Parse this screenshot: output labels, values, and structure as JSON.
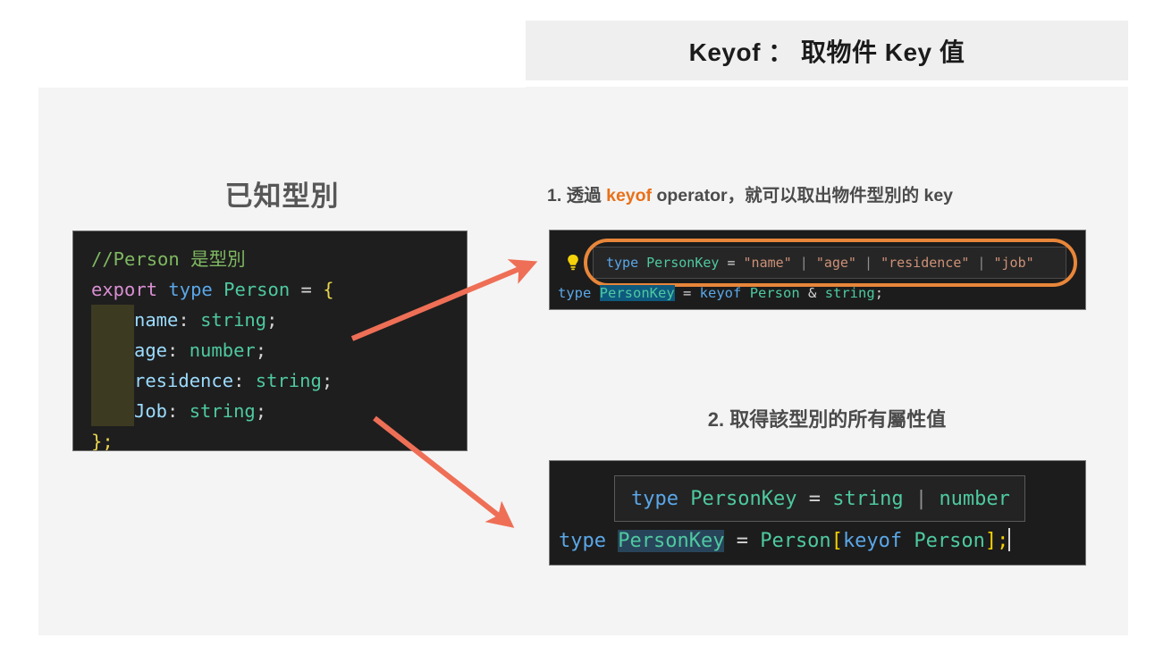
{
  "left_panel": {
    "title": "已知型別",
    "code": {
      "line1": {
        "comment": "//Person 是型別"
      },
      "line2": {
        "kw": "export",
        "type": "type",
        "name": "Person",
        "op": " = ",
        "brace": "{"
      },
      "line3": {
        "prop": "name",
        "colon": ": ",
        "value": "string",
        "semi": ";"
      },
      "line4": {
        "prop": "age",
        "colon": ": ",
        "value": "number",
        "semi": ";"
      },
      "line5": {
        "prop": "residence",
        "colon": ": ",
        "value": "string",
        "semi": ";"
      },
      "line6": {
        "prop": "Job",
        "colon": ": ",
        "value": "string",
        "semi": ";"
      },
      "line7": {
        "brace": "}",
        "semi": ";"
      }
    }
  },
  "right_panel": {
    "header_title": "Keyof ： 取物件 Key 值",
    "step1": {
      "prefix": "1. 透過 ",
      "highlight": "keyof",
      "suffix": " operator，就可以取出物件型別的 key",
      "tooltip": {
        "kw_type": "type",
        "name": "PersonKey",
        "eq": " = ",
        "str1": "\"name\"",
        "sep1": " | ",
        "str2": "\"age\"",
        "sep2": " | ",
        "str3": "\"residence\"",
        "sep3": " | ",
        "str4": "\"job\""
      },
      "code_line": {
        "kw_type": "type",
        "selected": "PersonKey",
        "eq": " = ",
        "keyof": "keyof",
        "person": "Person",
        "amp": " & ",
        "string": "string",
        "semi": ";"
      },
      "bulb_icon": "lightbulb-icon"
    },
    "step2": {
      "heading": "2. 取得該型別的所有屬性值",
      "tooltip": {
        "kw_type": "type",
        "name": "PersonKey",
        "eq": " = ",
        "val1": "string",
        "sep": " | ",
        "val2": "number"
      },
      "code_line": {
        "kw_type": "type",
        "selected": "PersonKey",
        "eq": " = ",
        "person": "Person",
        "lbracket": "[",
        "keyof": "keyof",
        "person2": " Person",
        "rbracket": "]",
        "semi": ";"
      }
    }
  },
  "annotations": {
    "arrow1": "arrow-to-step1",
    "arrow2": "arrow-to-step2",
    "arrow_color": "#ee6f56",
    "ring_color": "#e8863a",
    "accent_color": "#e8711a"
  }
}
